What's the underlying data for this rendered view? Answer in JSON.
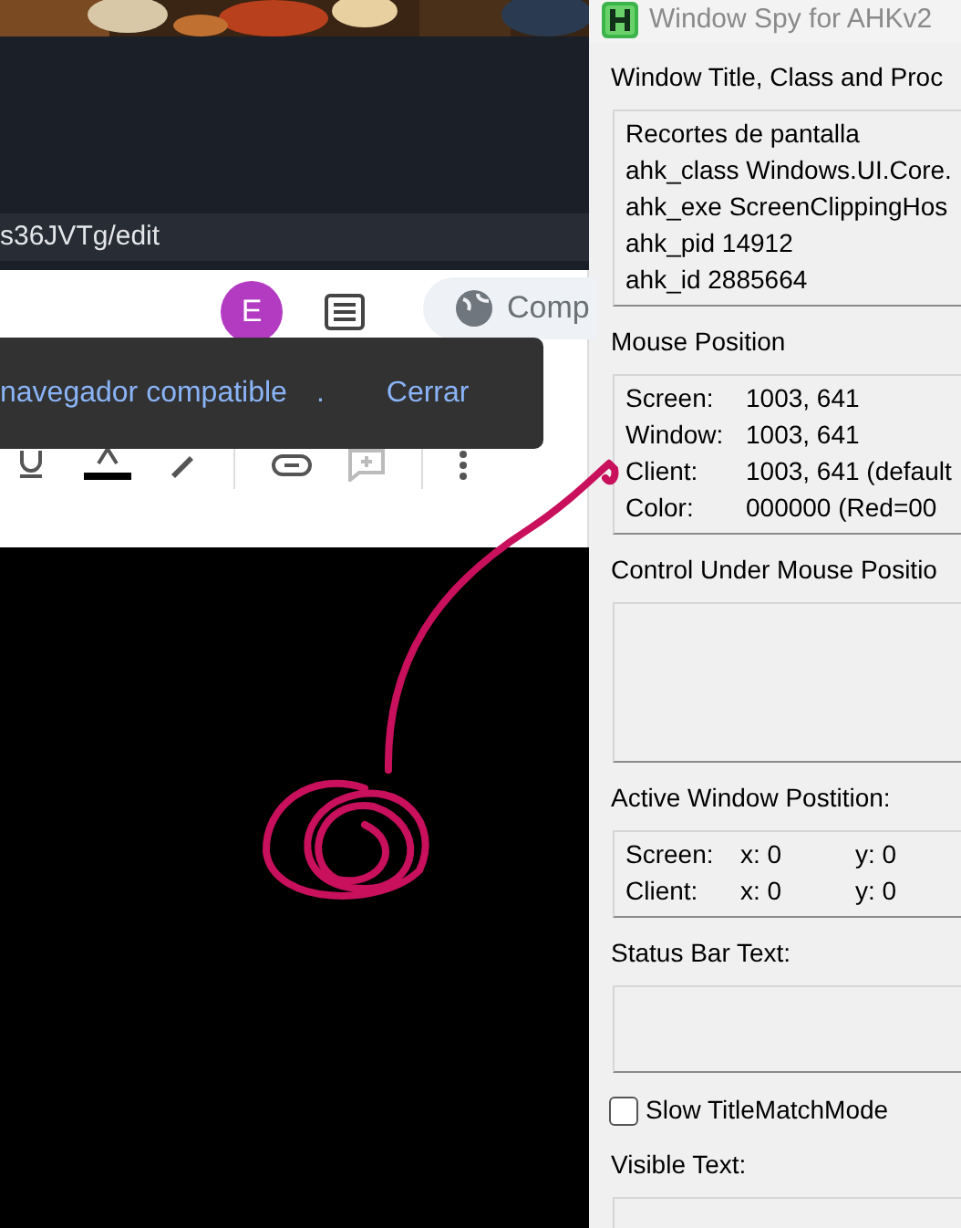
{
  "browser": {
    "address": "s36JVTg/edit",
    "avatar": "E",
    "share_button": "Comp"
  },
  "snackbar": {
    "message": "navegador compatible",
    "separator": ".",
    "action": "Cerrar"
  },
  "window": {
    "title": "Window Spy for AHKv2",
    "sections": [
      {
        "kind": "text",
        "label": "Window Title, Class and Proc",
        "lines": [
          "Recortes de pantalla",
          "ahk_class Windows.UI.Core.",
          "ahk_exe ScreenClippingHos",
          "ahk_pid 14912",
          "ahk_id 2885664"
        ]
      },
      {
        "kind": "table",
        "label": "Mouse Position",
        "rows": [
          [
            "Screen:",
            "1003, 641"
          ],
          [
            "Window:",
            "1003, 641"
          ],
          [
            "Client:",
            "1003, 641 (default"
          ],
          [
            "Color:",
            "000000 (Red=00"
          ]
        ]
      },
      {
        "kind": "large_box",
        "label": "Control Under Mouse Positio"
      },
      {
        "kind": "table",
        "label": "Active Window Postition:",
        "rows": [
          [
            "Screen:",
            "x: 0",
            "y: 0"
          ],
          [
            "Client:",
            "x: 0",
            "y: 0"
          ]
        ]
      },
      {
        "kind": "small_box",
        "label": "Status Bar Text:"
      },
      {
        "kind": "checkbox",
        "label": "Slow TitleMatchMode",
        "checked": false
      },
      {
        "kind": "partial_box",
        "label": "Visible Text:"
      }
    ]
  }
}
